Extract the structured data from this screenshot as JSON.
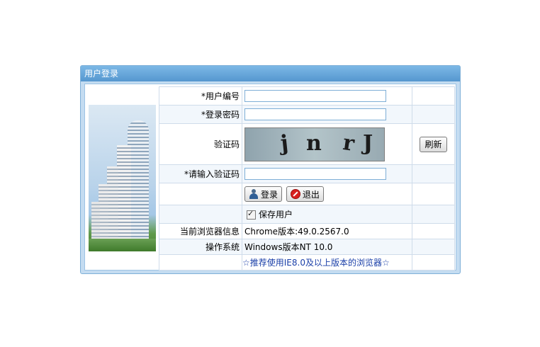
{
  "panel": {
    "title": "用户登录"
  },
  "form": {
    "user_id_label": "*用户编号",
    "user_id_value": "",
    "password_label": "*登录密码",
    "password_value": "",
    "captcha_label": "验证码",
    "captcha_chars": [
      "j",
      "n",
      "r",
      "J"
    ],
    "refresh_label": "刷新",
    "captcha_input_label": "*请输入验证码",
    "captcha_input_value": "",
    "login_label": "登录",
    "exit_label": "退出",
    "save_user_label": "保存用户",
    "save_user_checked": true,
    "browser_label": "当前浏览器信息",
    "browser_value": "Chrome版本:49.0.2567.0",
    "os_label": "操作系统",
    "os_value": "Windows版本NT 10.0",
    "recommend_text": "☆推荐使用IE8.0及以上版本的浏览器☆"
  },
  "icons": {
    "login": "user-icon",
    "exit": "stop-icon"
  },
  "colors": {
    "panel_border": "#7fb0d8",
    "title_bar": "#5597cf",
    "recommend_text": "#1a3fa8"
  }
}
